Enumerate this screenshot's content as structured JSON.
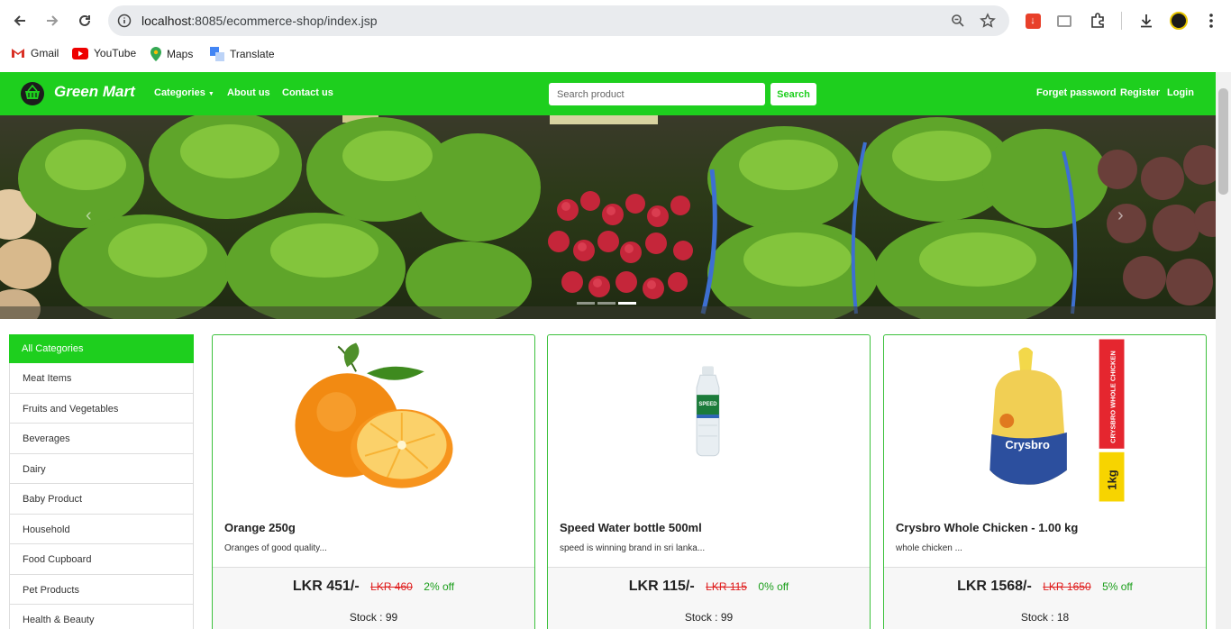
{
  "browser": {
    "url_host": "localhost",
    "url_rest": ":8085/ecommerce-shop/index.jsp",
    "bookmarks": [
      {
        "label": "Gmail",
        "icon": "gmail-icon"
      },
      {
        "label": "YouTube",
        "icon": "youtube-icon"
      },
      {
        "label": "Maps",
        "icon": "maps-icon"
      },
      {
        "label": "Translate",
        "icon": "translate-icon"
      }
    ]
  },
  "navbar": {
    "brand": "Green Mart",
    "categories": "Categories",
    "about": "About us",
    "contact": "Contact us",
    "search_placeholder": "Search product",
    "search_button": "Search",
    "forget_password": "Forget password",
    "register": "Register",
    "login": "Login",
    "accent": "#1ecf1e"
  },
  "carousel": {
    "slides": 3,
    "active_slide": 3
  },
  "sidebar": {
    "heading": "All Categories",
    "items": [
      "Meat Items",
      "Fruits and Vegetables",
      "Beverages",
      "Dairy",
      "Baby Product",
      "Household",
      "Food Cupboard",
      "Pet Products",
      "Health & Beauty"
    ]
  },
  "products": [
    {
      "title": "Orange 250g",
      "desc": "Oranges of good quality...",
      "price": "LKR 451/-",
      "old": "LKR 460",
      "off": "2% off",
      "stock": "Stock : 99"
    },
    {
      "title": "Speed Water bottle 500ml",
      "desc": "speed is winning brand in sri lanka...",
      "price": "LKR 115/-",
      "old": "LKR 115",
      "off": "0% off",
      "stock": "Stock : 99"
    },
    {
      "title": "Crysbro Whole Chicken - 1.00 kg",
      "desc": "whole chicken ...",
      "price": "LKR 1568/-",
      "old": "LKR 1650",
      "off": "5% off",
      "stock": "Stock : 18"
    }
  ],
  "product_images": {
    "speed_label": "SPEED",
    "crysbro_brand": "Crysbro",
    "crysbro_side": "CRYSBRO WHOLE CHICKEN",
    "crysbro_weight": "1kg"
  }
}
